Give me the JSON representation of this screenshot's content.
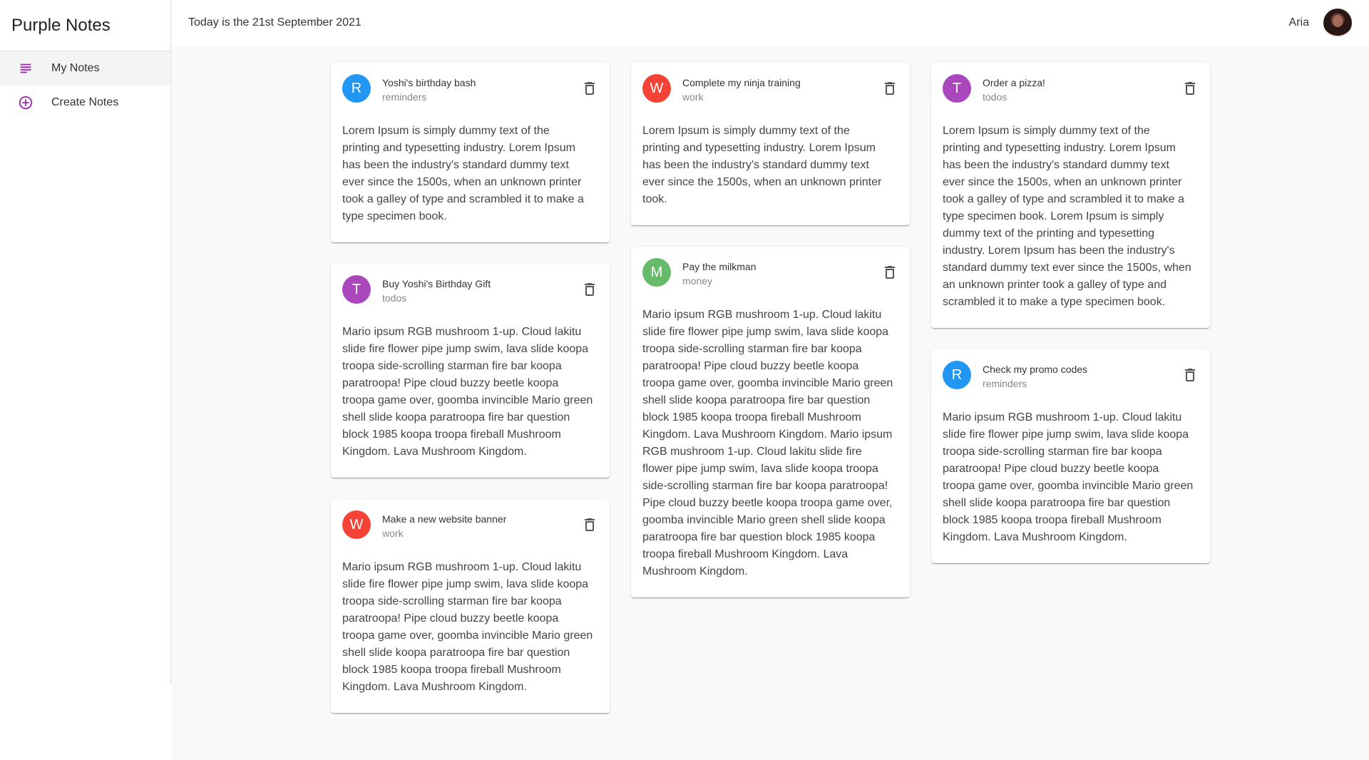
{
  "app": {
    "title": "Purple Notes"
  },
  "nav": {
    "items": [
      {
        "label": "My Notes",
        "icon": "subject-icon",
        "active": true
      },
      {
        "label": "Create Notes",
        "icon": "add-circle-icon",
        "active": false
      }
    ]
  },
  "header": {
    "date_text": "Today is the 21st September 2021",
    "user_name": "Aria"
  },
  "colors": {
    "accent": "#9c27b0",
    "reminders": "#2196f3",
    "work": "#f44336",
    "todos": "#ab47bc",
    "money": "#66bb6a"
  },
  "notes": [
    {
      "initial": "R",
      "title": "Yoshi's birthday bash",
      "category": "reminders",
      "body": "Lorem Ipsum is simply dummy text of the\nprinting and typesetting industry. Lorem Ipsum\nhas been the industry's standard dummy text\never since the 1500s, when an unknown printer\ntook a galley of type and scrambled it to make a\ntype specimen book."
    },
    {
      "initial": "W",
      "title": "Complete my ninja training",
      "category": "work",
      "body": "Lorem Ipsum is simply dummy text of the\nprinting and typesetting industry. Lorem Ipsum\nhas been the industry's standard dummy text\never since the 1500s, when an unknown printer\ntook."
    },
    {
      "initial": "T",
      "title": "Order a pizza!",
      "category": "todos",
      "body": "Lorem Ipsum is simply dummy text of the\nprinting and typesetting industry. Lorem Ipsum\nhas been the industry's standard dummy text\never since the 1500s, when an unknown printer\ntook a galley of type and scrambled it to make a\ntype specimen book. Lorem Ipsum is simply\ndummy text of the printing and typesetting\nindustry. Lorem Ipsum has been the industry's\nstandard dummy text ever since the 1500s, when\nan unknown printer took a galley of type and\nscrambled it to make a type specimen book."
    },
    {
      "initial": "T",
      "title": "Buy Yoshi's Birthday Gift",
      "category": "todos",
      "body": "Mario ipsum RGB mushroom 1-up. Cloud lakitu\nslide fire flower pipe jump swim, lava slide koopa\ntroopa side-scrolling starman fire bar koopa\nparatroopa! Pipe cloud buzzy beetle koopa\ntroopa game over, goomba invincible Mario green\nshell slide koopa paratroopa fire bar question\nblock 1985 koopa troopa fireball Mushroom\nKingdom. Lava Mushroom Kingdom."
    },
    {
      "initial": "M",
      "title": "Pay the milkman",
      "category": "money",
      "body": "Mario ipsum RGB mushroom 1-up. Cloud lakitu\nslide fire flower pipe jump swim, lava slide koopa\ntroopa side-scrolling starman fire bar koopa\nparatroopa! Pipe cloud buzzy beetle koopa\ntroopa game over, goomba invincible Mario green\nshell slide koopa paratroopa fire bar question\nblock 1985 koopa troopa fireball Mushroom\nKingdom. Lava Mushroom Kingdom. Mario ipsum\nRGB mushroom 1-up. Cloud lakitu slide fire\nflower pipe jump swim, lava slide koopa troopa\nside-scrolling starman fire bar koopa paratroopa!\nPipe cloud buzzy beetle koopa troopa game over,\ngoomba invincible Mario green shell slide koopa\nparatroopa fire bar question block 1985 koopa\ntroopa fireball Mushroom Kingdom. Lava\nMushroom Kingdom."
    },
    {
      "initial": "R",
      "title": "Check my promo codes",
      "category": "reminders",
      "body": "Mario ipsum RGB mushroom 1-up. Cloud lakitu\nslide fire flower pipe jump swim, lava slide koopa\ntroopa side-scrolling starman fire bar koopa\nparatroopa! Pipe cloud buzzy beetle koopa\ntroopa game over, goomba invincible Mario green\nshell slide koopa paratroopa fire bar question\nblock 1985 koopa troopa fireball Mushroom\nKingdom. Lava Mushroom Kingdom."
    },
    {
      "initial": "W",
      "title": "Make a new website banner",
      "category": "work",
      "body": "Mario ipsum RGB mushroom 1-up. Cloud lakitu\nslide fire flower pipe jump swim, lava slide koopa\ntroopa side-scrolling starman fire bar koopa\nparatroopa! Pipe cloud buzzy beetle koopa\ntroopa game over, goomba invincible Mario green\nshell slide koopa paratroopa fire bar question\nblock 1985 koopa troopa fireball Mushroom\nKingdom. Lava Mushroom Kingdom."
    }
  ]
}
